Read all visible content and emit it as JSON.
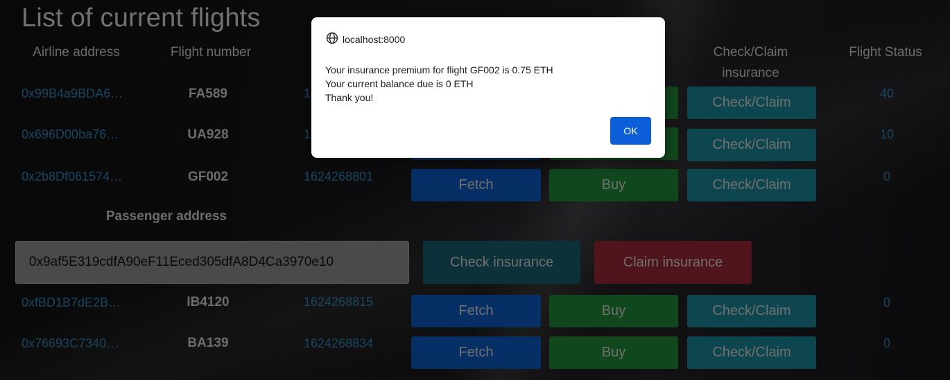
{
  "page": {
    "title": "List of current flights"
  },
  "headers": {
    "airline_address": "Airline address",
    "flight_number": "Flight number",
    "check_claim": "Check/Claim insurance",
    "flight_status": "Flight Status"
  },
  "flights": [
    {
      "address": "0x99B4a9BDA6…",
      "flight": "FA589",
      "timestamp": "1",
      "status": "40"
    },
    {
      "address": "0x696D00ba76…",
      "flight": "UA928",
      "timestamp": "1",
      "status": "10"
    },
    {
      "address": "0x2b8Df061574…",
      "flight": "GF002",
      "timestamp": "1624268801",
      "status": "0"
    },
    {
      "address": "0xfBD1B7dE2B…",
      "flight": "IB4120",
      "timestamp": "1624268815",
      "status": "0"
    },
    {
      "address": "0x76693C7340…",
      "flight": "BA139",
      "timestamp": "1624268834",
      "status": "0"
    }
  ],
  "buttons": {
    "fetch": "Fetch",
    "buy": "Buy",
    "check_claim": "Check/Claim"
  },
  "passenger": {
    "label": "Passenger address",
    "value": "0x9af5E319cdfA90eF11Eced305dfA8D4Ca3970e10",
    "check_label": "Check insurance",
    "claim_label": "Claim insurance"
  },
  "dialog": {
    "origin": "localhost:8000",
    "line1": "Your insurance premium for flight GF002 is 0.75 ETH",
    "line2": "Your current balance due is 0 ETH",
    "line3": "Thank you!",
    "ok_label": "OK"
  },
  "colors": {
    "fetch": "#0d5bc4",
    "buy": "#218838",
    "check": "#1a8796",
    "claim": "#992a36",
    "link": "#2e86b8",
    "ok": "#0b5ed7"
  }
}
